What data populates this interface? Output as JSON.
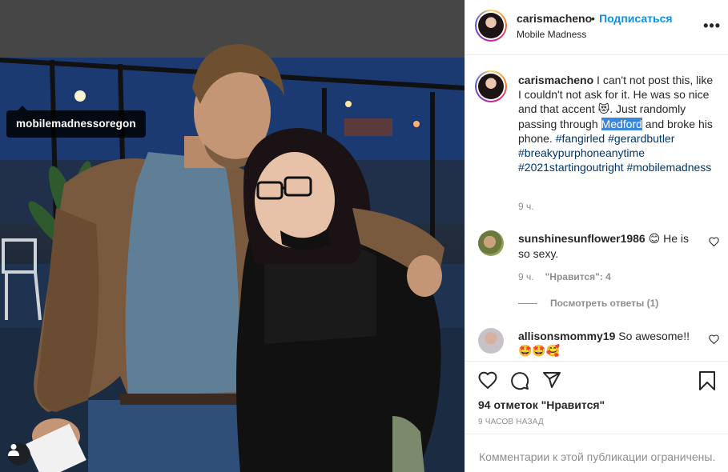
{
  "photo": {
    "tagged_user": "mobilemadnessoregon"
  },
  "header": {
    "username": "carismacheno",
    "separator": "•",
    "follow_label": "Подписаться",
    "location": "Mobile Madness",
    "more_icon": "more-options-icon"
  },
  "caption": {
    "username": "carismacheno",
    "text_1": " I can't not post this, like I couldn't not ask for it. He was so nice and that accent ",
    "emoji_1": "😻",
    "text_2": ". Just randomly passing through ",
    "highlight": "Medford",
    "text_3": " and broke his phone. ",
    "hashtags": [
      "#fangirled",
      "#gerardbutler",
      "#breakypurphoneanytime",
      "#2021startingoutright",
      "#mobilemadness"
    ],
    "time": "9 ч."
  },
  "comments": [
    {
      "username": "sunshinesunflower1986",
      "emoji": "😊",
      "text": " He is so sexy.",
      "time": "9 ч.",
      "likes_label": "\"Нравится\": 4",
      "view_replies": "Посмотреть ответы (1)"
    },
    {
      "username": "allisonsmommy19",
      "text": " So awesome!!",
      "emojis": "🤩🤩🥰"
    }
  ],
  "actions": {
    "like_icon": "heart-icon",
    "comment_icon": "comment-icon",
    "share_icon": "share-icon",
    "save_icon": "bookmark-icon"
  },
  "likes": "94 отметок \"Нравится\"",
  "post_time": "9 ЧАСОВ НАЗАД",
  "footer_notice": "Комментарии к этой публикации ограничены.",
  "colors": {
    "link": "#0095f6",
    "hashtag": "#00376b",
    "highlight": "#3c88d8",
    "muted": "#8e8e8e"
  }
}
